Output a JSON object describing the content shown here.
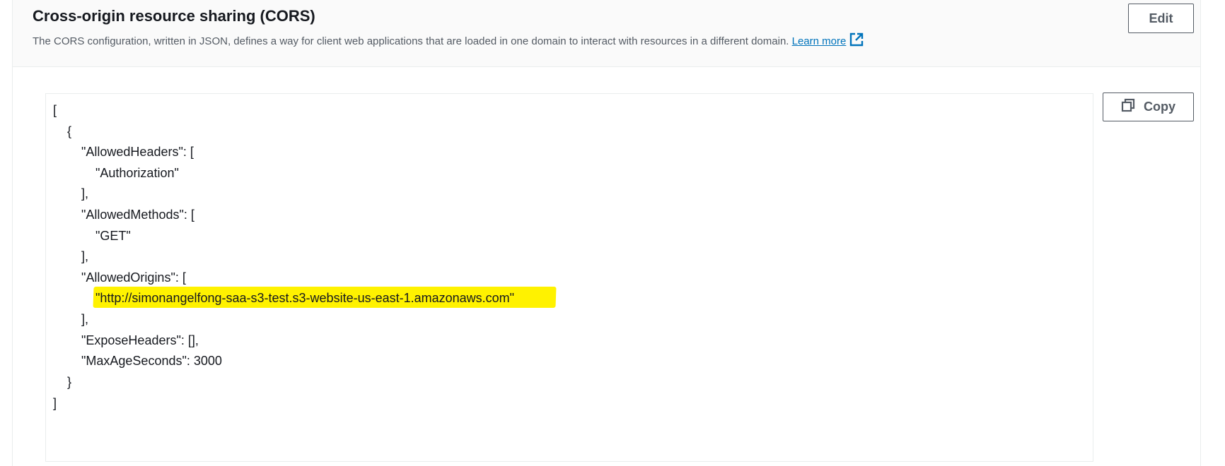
{
  "header": {
    "title": "Cross-origin resource sharing (CORS)",
    "description": "The CORS configuration, written in JSON, defines a way for client web applications that are loaded in one domain to interact with resources in a different domain.",
    "learn_more": "Learn more",
    "edit_label": "Edit"
  },
  "code": {
    "copy_label": "Copy",
    "lines": [
      "[",
      "    {",
      "        \"AllowedHeaders\": [",
      "            \"Authorization\"",
      "        ],",
      "        \"AllowedMethods\": [",
      "            \"GET\"",
      "        ],",
      "        \"AllowedOrigins\": [",
      "            \"http://simonangelfong-saa-s3-test.s3-website-us-east-1.amazonaws.com\"",
      "        ],",
      "        \"ExposeHeaders\": [],",
      "        \"MaxAgeSeconds\": 3000",
      "    }",
      "]"
    ]
  },
  "colors": {
    "link": "#0073bb",
    "highlight": "#fff200",
    "button_text": "#545b64"
  },
  "icons": [
    "external-link-icon",
    "copy-icon"
  ]
}
